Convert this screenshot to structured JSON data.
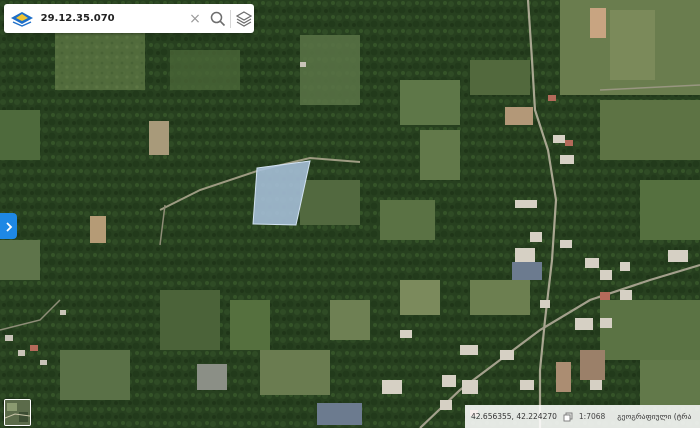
{
  "search": {
    "query": "29.12.35.070"
  },
  "icons": {
    "logo": "app-logo-icon",
    "clear": "close-icon",
    "search": "search-icon",
    "layers": "layers-icon",
    "expand": "chevron-right-icon",
    "copy": "copy-icon",
    "basemap": "basemap-thumbnail-icon"
  },
  "clear_glyph": "×",
  "status": {
    "coordinates": "42.656355, 42.224270",
    "scale": "1:7068",
    "layer": "გეოგრაფიული (ტრა"
  },
  "colors": {
    "accent": "#1e88e5",
    "parcel_fill": "#a9c2dc",
    "parcel_stroke": "#d2e2f2"
  }
}
